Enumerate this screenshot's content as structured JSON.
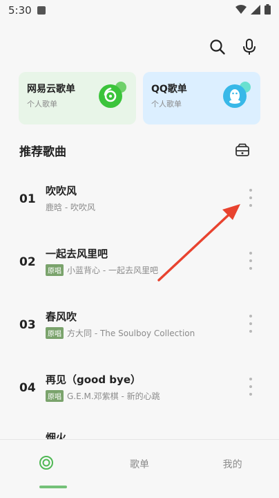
{
  "status_bar": {
    "time": "5:30"
  },
  "playlists": [
    {
      "title": "网易云歌单",
      "subtitle": "个人歌单"
    },
    {
      "title": "QQ歌单",
      "subtitle": "个人歌单"
    }
  ],
  "section": {
    "title": "推荐歌曲"
  },
  "songs": [
    {
      "index": "01",
      "title": "吹吹风",
      "badge": "",
      "subtitle": "鹿晗 - 吹吹风"
    },
    {
      "index": "02",
      "title": "一起去风里吧",
      "badge": "原唱",
      "subtitle": "小蓝背心 - 一起去风里吧"
    },
    {
      "index": "03",
      "title": "春风吹",
      "badge": "原唱",
      "subtitle": "方大同 - The Soulboy Collection"
    },
    {
      "index": "04",
      "title": "再见（good bye）",
      "badge": "原唱",
      "subtitle": "G.E.M.邓紫棋 - 新的心跳"
    }
  ],
  "partial_song": {
    "title": "烟火"
  },
  "bottom_nav": [
    {
      "label": ""
    },
    {
      "label": "歌单"
    },
    {
      "label": "我的"
    }
  ],
  "colors": {
    "accent": "#4fb854",
    "annotation": "#e8432f"
  }
}
